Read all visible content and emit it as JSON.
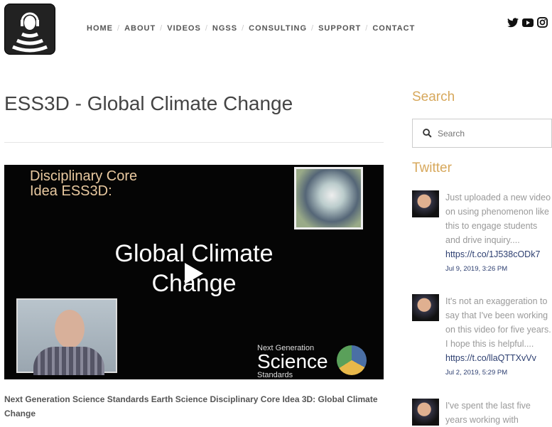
{
  "nav": [
    "HOME",
    "ABOUT",
    "VIDEOS",
    "NGSS",
    "CONSULTING",
    "SUPPORT",
    "CONTACT"
  ],
  "page_title": "ESS3D - Global Climate Change",
  "video": {
    "line1": "Disciplinary Core",
    "line2": "Idea ESS3D:",
    "title1": "Global Climate",
    "title2": "Change",
    "brand_top": "Next Generation",
    "brand_mid": "Science",
    "brand_bot": "Standards"
  },
  "caption": "Next Generation Science Standards Earth Science Disciplinary Core Idea 3D:  Global Climate Change",
  "sidebar": {
    "search_heading": "Search",
    "search_placeholder": "Search",
    "twitter_heading": "Twitter"
  },
  "tweets": [
    {
      "text": "Just uploaded a new video on using phenomenon like this to engage students and drive inquiry....",
      "link": "https://t.co/1J538cODk7",
      "date": "Jul 9, 2019, 3:26 PM"
    },
    {
      "text": "It's not an exaggeration to say that I've been working on this video for five years. I hope this is helpful....",
      "link": "https://t.co/llaQTTXvVv",
      "date": "Jul 2, 2019, 5:29 PM"
    },
    {
      "text": "I've spent the last five years working with",
      "link": null,
      "date": null
    }
  ]
}
